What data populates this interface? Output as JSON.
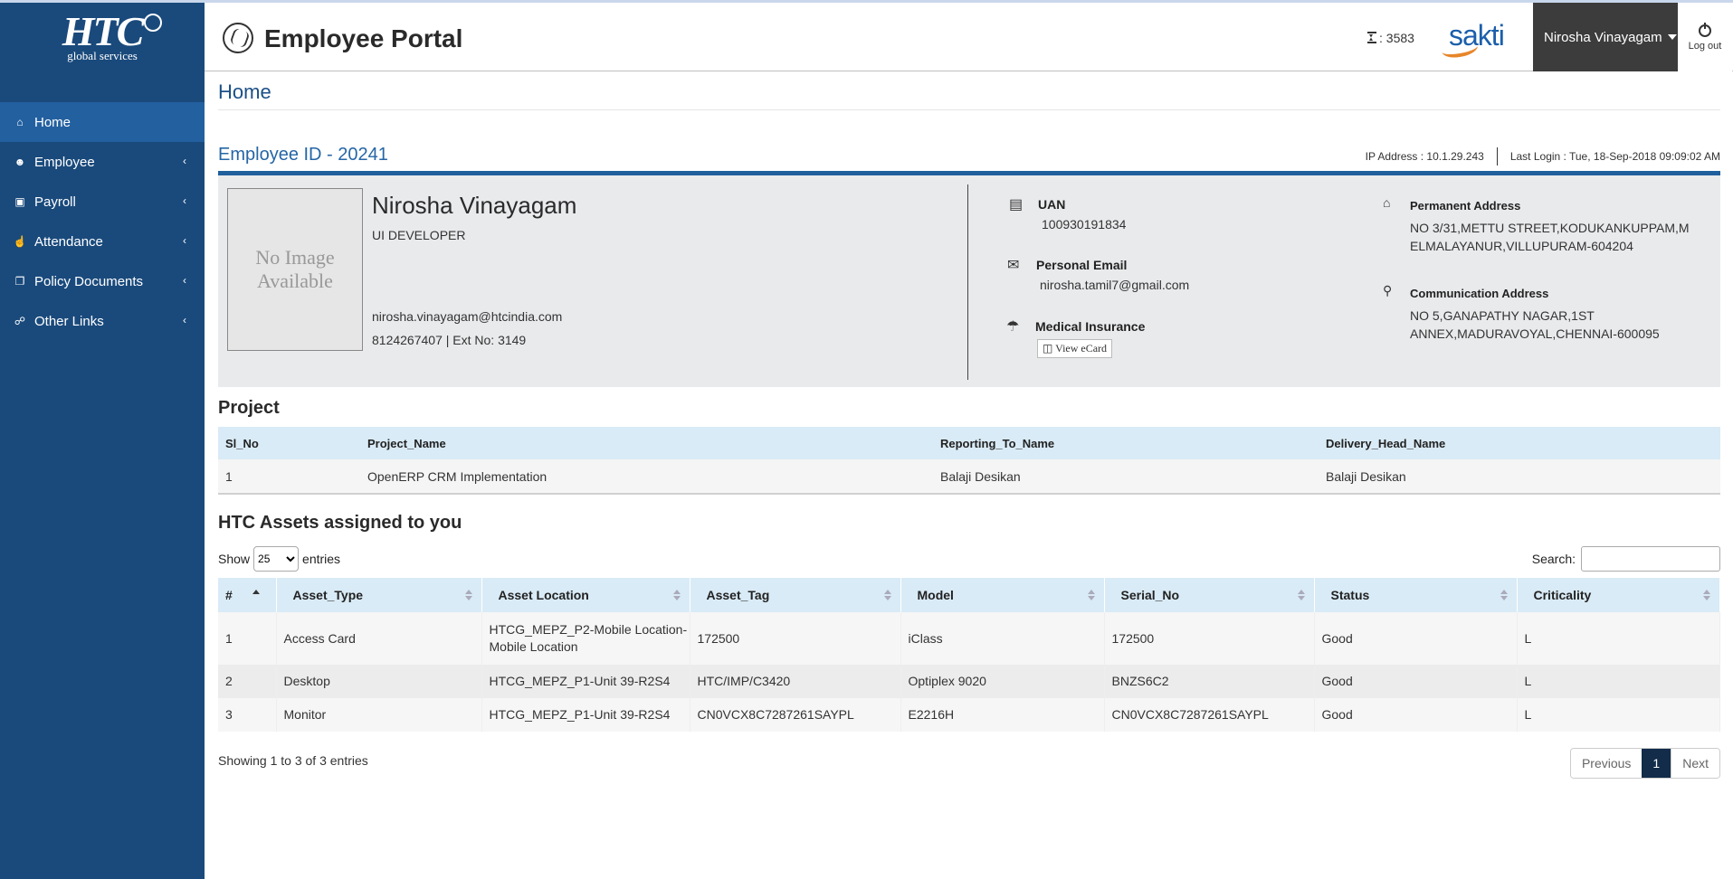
{
  "sidebar": {
    "logo_mark": "HTC",
    "logo_sub": "global services",
    "items": [
      {
        "label": "Home",
        "icon": "home-icon"
      },
      {
        "label": "Employee",
        "icon": "users-icon"
      },
      {
        "label": "Payroll",
        "icon": "money-icon"
      },
      {
        "label": "Attendance",
        "icon": "thumbs-up-icon"
      },
      {
        "label": "Policy Documents",
        "icon": "documents-icon"
      },
      {
        "label": "Other Links",
        "icon": "link-icon"
      }
    ]
  },
  "header": {
    "title": "Employee Portal",
    "counter": ": 3583",
    "sakti_logo": "sakti",
    "user_name": "Nirosha Vinayagam",
    "logout_label": "Log out"
  },
  "main": {
    "page_title": "Home",
    "employee_id": "Employee ID - 20241",
    "ip_address": "IP Address : 10.1.29.243",
    "last_login": "Last Login : Tue, 18-Sep-2018 09:09:02 AM",
    "profile": {
      "photo_text_1": "No Image",
      "photo_text_2": "Available",
      "name": "Nirosha Vinayagam",
      "role": "UI DEVELOPER",
      "email": "nirosha.vinayagam@htcindia.com",
      "phone": "8124267407 | Ext No: 3149",
      "uan_label": "UAN",
      "uan_value": "100930191834",
      "personal_email_label": "Personal Email",
      "personal_email_value": "nirosha.tamil7@gmail.com",
      "medical_label": "Medical Insurance",
      "ecard_label": "View eCard",
      "perm_addr_label": "Permanent Address",
      "perm_addr_value": "NO 3/31,METTU STREET,KODUKANKUPPAM,MELMALAYANUR,VILLUPURAM-604204",
      "comm_addr_label": "Communication Address",
      "comm_addr_value": "NO 5,GANAPATHY NAGAR,1ST ANNEX,MADURAVOYAL,CHENNAI-600095"
    },
    "project": {
      "title": "Project",
      "headers": [
        "Sl_No",
        "Project_Name",
        "Reporting_To_Name",
        "Delivery_Head_Name"
      ],
      "rows": [
        [
          "1",
          "OpenERP CRM Implementation",
          "Balaji Desikan",
          "Balaji Desikan"
        ]
      ]
    },
    "assets": {
      "title": "HTC Assets assigned to you",
      "show_label": "Show",
      "entries_value": "25",
      "entries_label": "entries",
      "search_label": "Search:",
      "headers": [
        "#",
        "Asset_Type",
        "Asset Location",
        "Asset_Tag",
        "Model",
        "Serial_No",
        "Status",
        "Criticality"
      ],
      "rows": [
        [
          "1",
          "Access Card",
          "HTCG_MEPZ_P2-Mobile Location-Mobile Location",
          "172500",
          "iClass",
          "172500",
          "Good",
          "L"
        ],
        [
          "2",
          "Desktop",
          "HTCG_MEPZ_P1-Unit 39-R2S4",
          "HTC/IMP/C3420",
          "Optiplex 9020",
          "BNZS6C2",
          "Good",
          "L"
        ],
        [
          "3",
          "Monitor",
          "HTCG_MEPZ_P1-Unit 39-R2S4",
          "CN0VCX8C7287261SAYPL",
          "E2216H",
          "CN0VCX8C7287261SAYPL",
          "Good",
          "L"
        ]
      ],
      "info": "Showing 1 to 3 of 3 entries",
      "prev_label": "Previous",
      "current_page": "1",
      "next_label": "Next"
    }
  }
}
